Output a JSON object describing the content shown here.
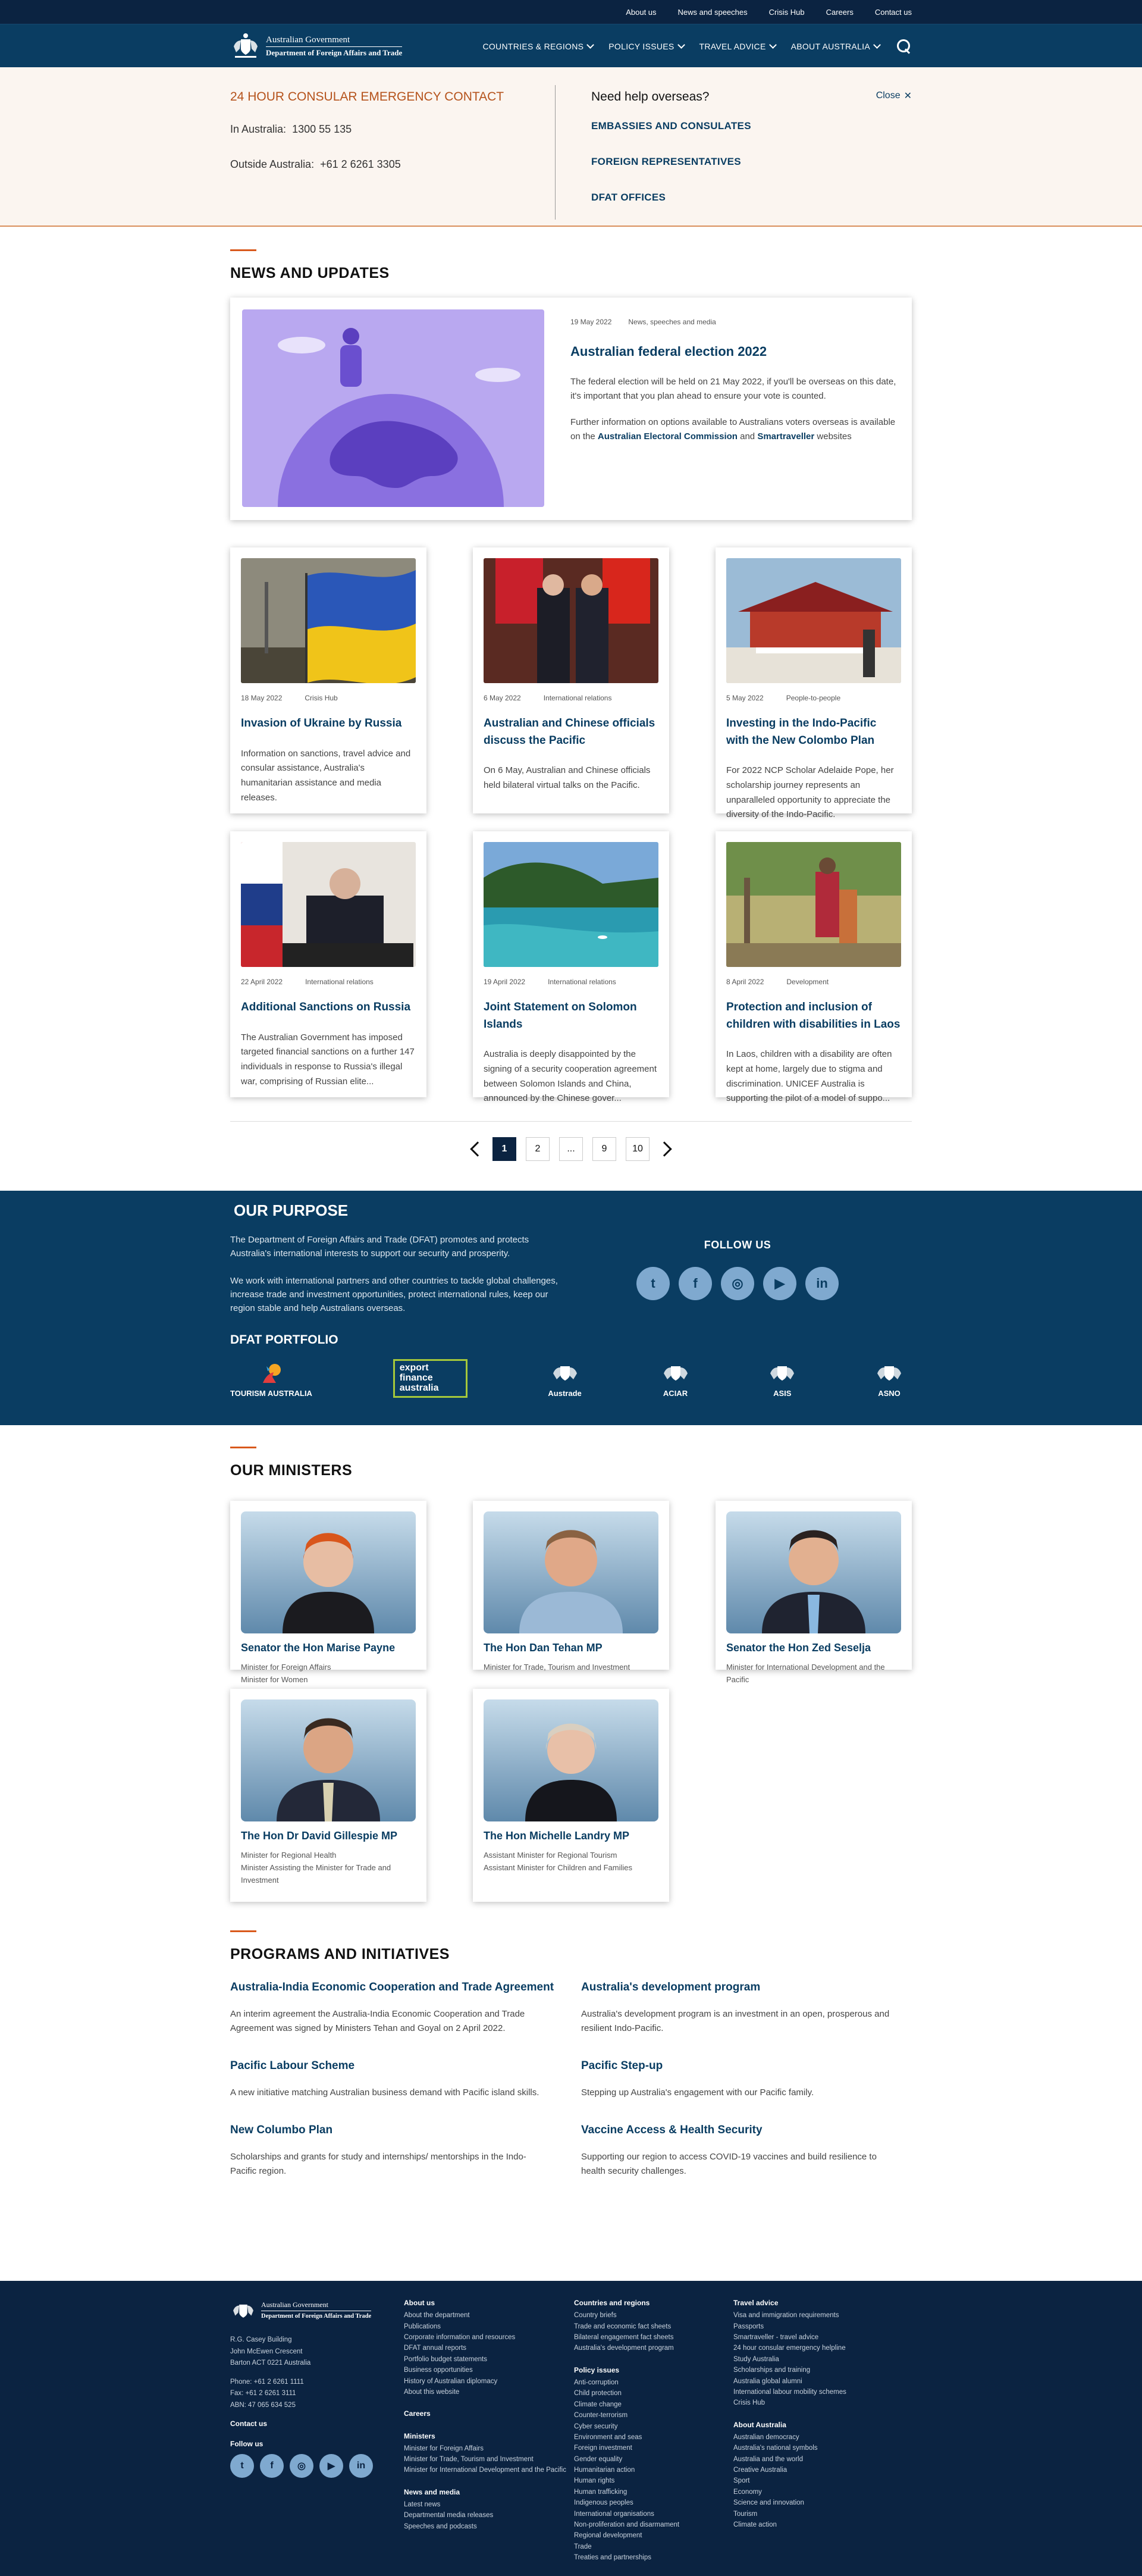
{
  "util_links": [
    "About us",
    "News and speeches",
    "Crisis Hub",
    "Careers",
    "Contact us"
  ],
  "logo": {
    "line1": "Australian Government",
    "line2": "Department of Foreign Affairs and Trade"
  },
  "nav": [
    "COUNTRIES & REGIONS",
    "POLICY ISSUES",
    "TRAVEL ADVICE",
    "ABOUT AUSTRALIA"
  ],
  "consular": {
    "title": "24 HOUR CONSULAR EMERGENCY CONTACT",
    "in_label": "In Australia:",
    "in_num": "1300 55 135",
    "out_label": "Outside Australia:",
    "out_num": "+61 2 6261 3305",
    "help_title": "Need help overseas?",
    "links": [
      "EMBASSIES AND CONSULATES",
      "FOREIGN REPRESENTATIVES",
      "DFAT OFFICES"
    ],
    "close": "Close"
  },
  "news_title": "NEWS AND UPDATES",
  "featured": {
    "date": "19 May 2022",
    "category": "News, speeches and media",
    "title": "Australian federal election 2022",
    "p1": "The federal election will be held on 21 May 2022, if you'll be overseas on this date, it's important that you plan ahead to ensure your vote is counted.",
    "p2a": "Further information on options available to Australians voters overseas is available on the ",
    "p2b": "Australian Electoral Commission",
    "p2c": " and ",
    "p2d": "Smartraveller",
    "p2e": " websites"
  },
  "news": [
    {
      "date": "18 May 2022",
      "cat": "Crisis Hub",
      "title": "Invasion of Ukraine by Russia",
      "text": "Information on sanctions, travel advice and consular assistance, Australia's humanitarian assistance and media releases."
    },
    {
      "date": "6 May 2022",
      "cat": "International relations",
      "title": "Australian and Chinese officials discuss the Pacific",
      "text": "On 6 May, Australian and Chinese officials held bilateral virtual talks on the Pacific."
    },
    {
      "date": "5 May 2022",
      "cat": "People-to-people",
      "title": "Investing in the Indo-Pacific with the New Colombo Plan",
      "text": "For 2022 NCP Scholar Adelaide Pope, her scholarship journey represents an unparalleled opportunity to appreciate the diversity of the Indo-Pacific."
    },
    {
      "date": "22 April 2022",
      "cat": "International relations",
      "title": "Additional Sanctions on Russia",
      "text": "The Australian Government has imposed targeted financial sanctions on a further 147 individuals in response to Russia's illegal war, comprising of Russian elite..."
    },
    {
      "date": "19 April 2022",
      "cat": "International relations",
      "title": "Joint Statement on Solomon Islands",
      "text": "Australia is deeply disappointed by the signing of a security cooperation agreement between Solomon Islands and China, announced by the Chinese gover..."
    },
    {
      "date": "8 April 2022",
      "cat": "Development",
      "title": "Protection and inclusion of children with disabilities in Laos",
      "text": "In Laos, children with a disability are often kept at home, largely due to stigma and discrimination. UNICEF Australia is supporting the pilot of a model of suppo..."
    }
  ],
  "pager": [
    "1",
    "2",
    "...",
    "9",
    "10"
  ],
  "purpose": {
    "title": "OUR PURPOSE",
    "p1": "The Department of Foreign Affairs and Trade (DFAT) promotes and protects Australia's international interests to support our security and prosperity.",
    "p2": "We work with international partners and other countries to tackle global challenges, increase trade and investment opportunities, protect international rules, keep our region stable and help Australians overseas.",
    "follow": "FOLLOW US",
    "portfolio": "DFAT PORTFOLIO",
    "pf": [
      "TOURISM AUSTRALIA",
      "export finance australia",
      "Austrade",
      "ACIAR",
      "ASIS",
      "ASNO"
    ]
  },
  "ministers_title": "OUR MINISTERS",
  "ministers": [
    {
      "name": "Senator the Hon Marise Payne",
      "roles": [
        "Minister for Foreign Affairs",
        "Minister for Women"
      ]
    },
    {
      "name": "The Hon Dan Tehan MP",
      "roles": [
        "Minister for Trade, Tourism and Investment"
      ]
    },
    {
      "name": "Senator the Hon Zed Seselja",
      "roles": [
        "Minister for International Development and the Pacific"
      ]
    },
    {
      "name": "The Hon Dr David Gillespie MP",
      "roles": [
        "Minister for Regional Health",
        "Minister Assisting the Minister for Trade and Investment"
      ]
    },
    {
      "name": "The Hon Michelle Landry MP",
      "roles": [
        "Assistant Minister for Regional Tourism",
        "Assistant Minister for Children and Families"
      ]
    }
  ],
  "programs_title": "PROGRAMS AND INITIATIVES",
  "programs": [
    {
      "title": "Australia-India Economic Cooperation and Trade Agreement",
      "text": "An interim agreement the Australia-India Economic Cooperation and Trade Agreement was signed by Ministers Tehan and Goyal on 2 April 2022."
    },
    {
      "title": "Australia's development program",
      "text": "Australia's development program is an investment in an open, prosperous and resilient Indo-Pacific."
    },
    {
      "title": "Pacific Labour Scheme",
      "text": "A new initiative matching Australian business demand with Pacific island skills."
    },
    {
      "title": "Pacific Step-up",
      "text": "Stepping up Australia's engagement with our Pacific family."
    },
    {
      "title": "New Columbo Plan",
      "text": "Scholarships and grants for study and internships/ mentorships in the Indo-Pacific region."
    },
    {
      "title": "Vaccine Access & Health Security",
      "text": "Supporting our region to access COVID-19 vaccines and build resilience to health security challenges."
    }
  ],
  "footer": {
    "addr": [
      "R.G. Casey Building",
      "John McEwen Crescent",
      "Barton ACT 0221 Australia"
    ],
    "phone": [
      "Phone: +61 2 6261 1111",
      "Fax: +61 2 6261 3111",
      "ABN: 47 065 634 525"
    ],
    "contact": "Contact us",
    "follow": "Follow us",
    "colA": [
      {
        "h": "About us",
        "items": [
          "About the department",
          "Publications",
          "Corporate information and resources",
          "DFAT annual reports",
          "Portfolio budget statements",
          "Business opportunities",
          "History of Australian diplomacy",
          "About this website"
        ]
      },
      {
        "h": "Careers",
        "items": []
      },
      {
        "h": "Ministers",
        "items": [
          "Minister for Foreign Affairs",
          "Minister for Trade, Tourism and Investment",
          "Minister for International Development and the Pacific"
        ]
      },
      {
        "h": "News and media",
        "items": [
          "Latest news",
          "Departmental media releases",
          "Speeches and podcasts"
        ]
      }
    ],
    "colB": [
      {
        "h": "Countries and regions",
        "items": [
          "Country briefs",
          "Trade and economic fact sheets",
          "Bilateral engagement fact sheets",
          "Australia's development program"
        ]
      },
      {
        "h": "Policy issues",
        "items": [
          "Anti-corruption",
          "Child protection",
          "Climate change",
          "Counter-terrorism",
          "Cyber security",
          "Environment and seas",
          "Foreign investment",
          "Gender equality",
          "Humanitarian action",
          "Human rights",
          "Human trafficking",
          "Indigenous peoples",
          "International organisations",
          "Non-proliferation and disarmament",
          "Regional development",
          "Trade",
          "Treaties and partnerships"
        ]
      }
    ],
    "colC": [
      {
        "h": "Travel advice",
        "items": [
          "Visa and immigration requirements",
          "Passports",
          "Smartraveller - travel advice",
          "24 hour consular emergency helpline",
          "Study Australia",
          "Scholarships and training",
          "Australia global alumni",
          "International labour mobility schemes",
          "Crisis Hub"
        ]
      },
      {
        "h": "About Australia",
        "items": [
          "Australian democracy",
          "Australia's national symbols",
          "Australia and the world",
          "Creative Australia",
          "Sport",
          "Economy",
          "Science and innovation",
          "Tourism",
          "Climate action"
        ]
      }
    ]
  },
  "social": [
    "twitter-icon",
    "facebook-icon",
    "instagram-icon",
    "youtube-icon",
    "linkedin-icon"
  ]
}
